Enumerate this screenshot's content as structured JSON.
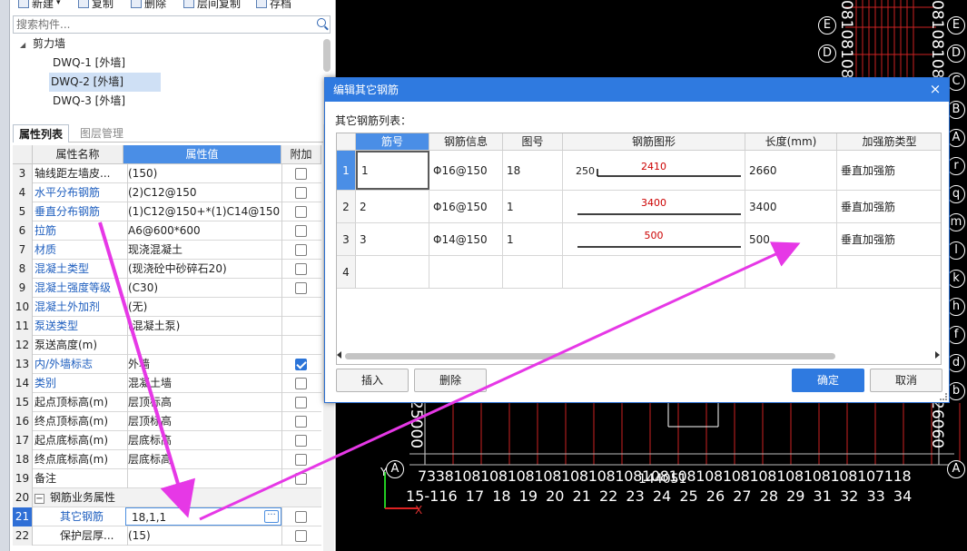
{
  "toolbar": {
    "new_label": "新建",
    "copy_label": "复制",
    "delete_label": "删除",
    "layer_copy_label": "层间复制",
    "save_label": "存档"
  },
  "search": {
    "placeholder": "搜索构件..."
  },
  "tree": {
    "group_label": "剪力墙",
    "items": [
      "DWQ-1 [外墙]",
      "DWQ-2 [外墙]",
      "DWQ-3 [外墙]"
    ],
    "selected_index": 1
  },
  "tabs": {
    "properties": "属性列表",
    "layers": "图层管理"
  },
  "grid": {
    "headers": {
      "name": "属性名称",
      "value": "属性值",
      "extra": "附加"
    },
    "rows": [
      {
        "num": "3",
        "name": "轴线距左墙皮...",
        "value": "(150)",
        "blue": false,
        "check": false
      },
      {
        "num": "4",
        "name": "水平分布钢筋",
        "value": "(2)C12@150",
        "blue": true,
        "check": false
      },
      {
        "num": "5",
        "name": "垂直分布钢筋",
        "value": "(1)C12@150+*(1)C14@150",
        "blue": true,
        "check": false
      },
      {
        "num": "6",
        "name": "拉筋",
        "value": "A6@600*600",
        "blue": true,
        "check": false
      },
      {
        "num": "7",
        "name": "材质",
        "value": "现浇混凝土",
        "blue": true,
        "check": false
      },
      {
        "num": "8",
        "name": "混凝土类型",
        "value": "(现浇砼中砂碎石20)",
        "blue": true,
        "check": false
      },
      {
        "num": "9",
        "name": "混凝土强度等级",
        "value": "(C30)",
        "blue": true,
        "check": false
      },
      {
        "num": "10",
        "name": "混凝土外加剂",
        "value": "(无)",
        "blue": true,
        "check": null
      },
      {
        "num": "11",
        "name": "泵送类型",
        "value": "(混凝土泵)",
        "blue": true,
        "check": null
      },
      {
        "num": "12",
        "name": "泵送高度(m)",
        "value": "",
        "blue": false,
        "check": null
      },
      {
        "num": "13",
        "name": "内/外墙标志",
        "value": "外墙",
        "blue": true,
        "check": true
      },
      {
        "num": "14",
        "name": "类别",
        "value": "混凝土墙",
        "blue": true,
        "check": false
      },
      {
        "num": "15",
        "name": "起点顶标高(m)",
        "value": "层顶标高",
        "blue": false,
        "check": false
      },
      {
        "num": "16",
        "name": "终点顶标高(m)",
        "value": "层顶标高",
        "blue": false,
        "check": false
      },
      {
        "num": "17",
        "name": "起点底标高(m)",
        "value": "层底标高",
        "blue": false,
        "check": false
      },
      {
        "num": "18",
        "name": "终点底标高(m)",
        "value": "层底标高",
        "blue": false,
        "check": false
      },
      {
        "num": "19",
        "name": "备注",
        "value": "",
        "blue": false,
        "check": false
      }
    ],
    "group_row": {
      "num": "20",
      "toggle": "−",
      "name": "钢筋业务属性"
    },
    "sel_row": {
      "num": "21",
      "name": "其它钢筋",
      "value": "18,1,1",
      "button": "···"
    },
    "row22": {
      "num": "22",
      "name": "保护层厚...",
      "value": "(15)"
    }
  },
  "cad": {
    "left_axis_labels": [
      "E",
      "D"
    ],
    "right_axis_labels": [
      "E",
      "D",
      "C",
      "B",
      "A",
      "r",
      "q",
      "m",
      "l",
      "k",
      "h",
      "f",
      "d",
      "b"
    ],
    "bottom_axis_label": "A",
    "left_v_text": "25000",
    "right_v_text": "26060",
    "dim_text": "7338108108108108108108108108108108108108108108108107118",
    "sub_dim_text": "144051",
    "axis_numbers": "15-116 17 18 19 20 21 22 23 24 25 26 27 28 29 31 32 33 34",
    "top_v_text": "08108108",
    "right_top_v_text": "08108108",
    "y_label": "Y",
    "x_label": "X"
  },
  "dialog": {
    "title": "编辑其它钢筋",
    "close": "×",
    "list_label": "其它钢筋列表：",
    "columns": [
      "筋号",
      "钢筋信息",
      "图号",
      "钢筋图形",
      "长度(mm)",
      "加强筋类型"
    ],
    "rows": [
      {
        "num": "1",
        "id": "1",
        "info": "Φ16@150",
        "figure": "18",
        "shape_left": "250",
        "shape_mid": "2410",
        "length": "2660",
        "type": "垂直加强筋"
      },
      {
        "num": "2",
        "id": "2",
        "info": "Φ16@150",
        "figure": "1",
        "shape_left": "",
        "shape_mid": "3400",
        "length": "3400",
        "type": "垂直加强筋"
      },
      {
        "num": "3",
        "id": "3",
        "info": "Φ14@150",
        "figure": "1",
        "shape_left": "",
        "shape_mid": "500",
        "length": "500",
        "type": "垂直加强筋"
      },
      {
        "num": "4",
        "id": "",
        "info": "",
        "figure": "",
        "shape_left": "",
        "shape_mid": "",
        "length": "",
        "type": ""
      }
    ],
    "buttons": {
      "insert": "插入",
      "delete": "删除",
      "ok": "确定",
      "cancel": "取消"
    }
  },
  "colors": {
    "accent": "#2f7ae0",
    "annotation_arrow": "#e638e6",
    "cad_red": "#cc2222",
    "shape_label": "#cc0000"
  }
}
